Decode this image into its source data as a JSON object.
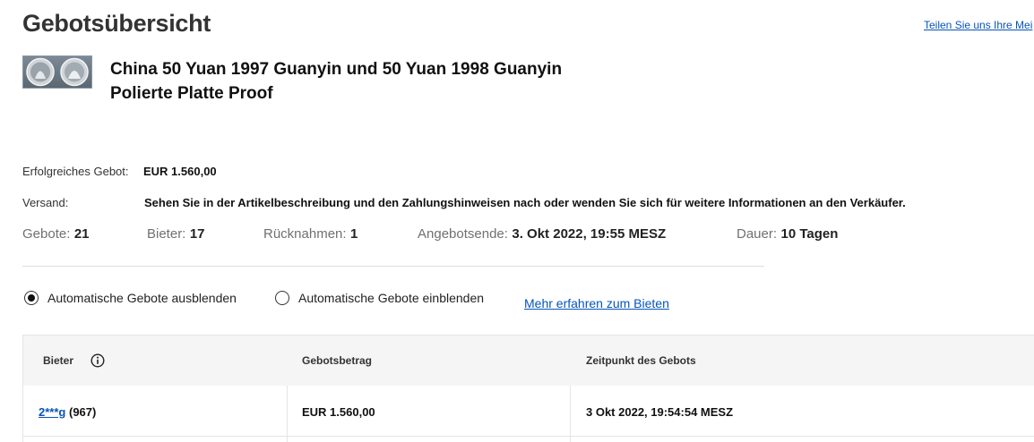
{
  "header": {
    "title": "Gebotsübersicht",
    "feedback_link": "Teilen Sie uns Ihre Mei"
  },
  "item": {
    "title_line1": "China 50 Yuan 1997 Guanyin und 50 Yuan 1998 Guanyin",
    "title_line2": "Polierte Platte Proof"
  },
  "summary": {
    "winning_bid_label": "Erfolgreiches Gebot:",
    "winning_bid_value": "EUR 1.560,00",
    "shipping_label": "Versand:",
    "shipping_value": "Sehen Sie in der Artikelbeschreibung und den Zahlungshinweisen nach oder wenden Sie sich für weitere Informationen an den Verkäufer."
  },
  "stats": {
    "bids_label": "Gebote:",
    "bids_value": "21",
    "bidders_label": "Bieter:",
    "bidders_value": "17",
    "retractions_label": "Rücknahmen:",
    "retractions_value": "1",
    "end_label": "Angebotsende:",
    "end_value": "3. Okt 2022, 19:55 MESZ",
    "duration_label": "Dauer:",
    "duration_value": "10 Tagen"
  },
  "options": {
    "hide_auto_label": "Automatische Gebote ausblenden",
    "hide_auto_selected": true,
    "show_auto_label": "Automatische Gebote einblenden",
    "show_auto_selected": false,
    "learn_more_link": "Mehr erfahren zum Bieten"
  },
  "table": {
    "headers": {
      "bidder": "Bieter",
      "amount": "Gebotsbetrag",
      "time": "Zeitpunkt des Gebots"
    },
    "rows": [
      {
        "bidder": "2***g",
        "feedback": "(967)",
        "amount": "EUR 1.560,00",
        "time": "3 Okt 2022, 19:54:54 MESZ"
      }
    ]
  },
  "icons": {
    "info": "info-icon",
    "radio": "radio-icon"
  },
  "colors": {
    "link": "#0654ba",
    "table_header_bg": "#f5f5f5"
  }
}
